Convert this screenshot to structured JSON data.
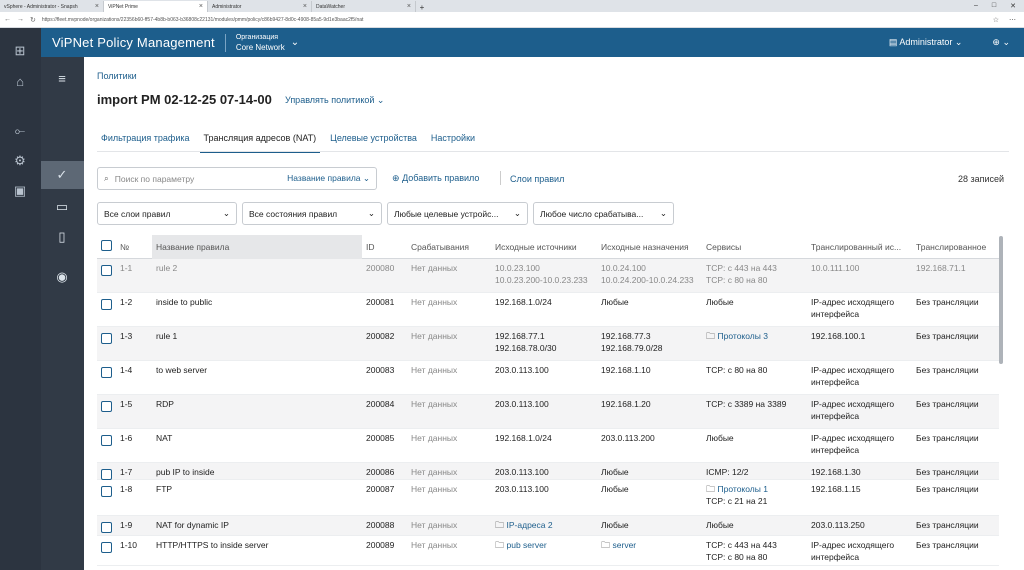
{
  "browser": {
    "tabs": [
      {
        "label": "vSphere - Administrator - Snapsh",
        "active": false
      },
      {
        "label": "ViPNet Prime",
        "active": true
      },
      {
        "label": "Administrator",
        "active": false
      },
      {
        "label": "DataWatcher",
        "active": false
      }
    ],
    "url": "https://fleet.mvpnode/organizations/22356b60-ff57-4b8b-b063-b36808c22131/modules/pmm/policy/c86b9427-8d0c-4908-85a5-9d1e3baac2f5/nat"
  },
  "header": {
    "app_name": "ViPNet Policy Management",
    "org_label": "Организация",
    "org_value": "Core Network",
    "user": "Administrator"
  },
  "page": {
    "breadcrumb": "Политики",
    "title": "import PM 02-12-25 07-14-00",
    "manage": "Управлять политикой",
    "tabs": [
      "Фильтрация трафика",
      "Трансляция адресов (NAT)",
      "Целевые устройства",
      "Настройки"
    ],
    "active_tab": 1,
    "search_placeholder": "Поиск по параметру",
    "search_field": "Название правила",
    "add_rule": "Добавить правило",
    "layers": "Слои правил",
    "records": "28 записей",
    "filters": [
      "Все слои правил",
      "Все состояния правил",
      "Любые целевые устройс...",
      "Любое число срабатыва..."
    ]
  },
  "table": {
    "columns": [
      "№",
      "Название правила",
      "ID",
      "Срабатывания",
      "Исходные источники",
      "Исходные назначения",
      "Сервисы",
      "Транслированный ис...",
      "Транслированное"
    ],
    "rows": [
      {
        "num": "1-1",
        "name": "rule 2",
        "id": "200080",
        "hits": "Нет данных",
        "src": [
          "10.0.23.100",
          "10.0.23.200-10.0.23.233"
        ],
        "dst": [
          "10.0.24.100",
          "10.0.24.200-10.0.24.233"
        ],
        "svc": [
          "TCP: с 443 на 443",
          "TCP: с 80 на 80"
        ],
        "tsrc": [
          "10.0.111.100"
        ],
        "tdst": [
          "192.168.71.1"
        ],
        "disabled": true
      },
      {
        "num": "1-2",
        "name": "inside to public",
        "id": "200081",
        "hits": "Нет данных",
        "src": [
          "192.168.1.0/24"
        ],
        "dst": [
          "Любые"
        ],
        "svc": [
          "Любые"
        ],
        "tsrc": [
          "IP-адрес исходящего",
          "интерфейса"
        ],
        "tdst": [
          "Без трансляции"
        ]
      },
      {
        "num": "1-3",
        "name": "rule 1",
        "id": "200082",
        "hits": "Нет данных",
        "src": [
          "192.168.77.1",
          "192.168.78.0/30"
        ],
        "dst": [
          "192.168.77.3",
          "192.168.79.0/28"
        ],
        "svc": [
          "Протоколы 3"
        ],
        "svc_folder": true,
        "tsrc": [
          "192.168.100.1"
        ],
        "tdst": [
          "Без трансляции"
        ]
      },
      {
        "num": "1-4",
        "name": "to web server",
        "id": "200083",
        "hits": "Нет данных",
        "src": [
          "203.0.113.100"
        ],
        "dst": [
          "192.168.1.10"
        ],
        "svc": [
          "TCP: с 80 на 80"
        ],
        "tsrc": [
          "IP-адрес исходящего",
          "интерфейса"
        ],
        "tdst": [
          "Без трансляции"
        ]
      },
      {
        "num": "1-5",
        "name": "RDP",
        "id": "200084",
        "hits": "Нет данных",
        "src": [
          "203.0.113.100"
        ],
        "dst": [
          "192.168.1.20"
        ],
        "svc": [
          "TCP: с 3389 на 3389"
        ],
        "tsrc": [
          "IP-адрес исходящего",
          "интерфейса"
        ],
        "tdst": [
          "Без трансляции"
        ]
      },
      {
        "num": "1-6",
        "name": "NAT",
        "id": "200085",
        "hits": "Нет данных",
        "src": [
          "192.168.1.0/24"
        ],
        "dst": [
          "203.0.113.200"
        ],
        "svc": [
          "Любые"
        ],
        "tsrc": [
          "IP-адрес исходящего",
          "интерфейса"
        ],
        "tdst": [
          "Без трансляции"
        ]
      },
      {
        "num": "1-7",
        "name": "pub IP to inside",
        "id": "200086",
        "hits": "Нет данных",
        "src": [
          "203.0.113.100"
        ],
        "dst": [
          "Любые"
        ],
        "svc": [
          "ICMP: 12/2"
        ],
        "tsrc": [
          "192.168.1.30"
        ],
        "tdst": [
          "Без трансляции"
        ]
      },
      {
        "num": "1-8",
        "name": "FTP",
        "id": "200087",
        "hits": "Нет данных",
        "src": [
          "203.0.113.100"
        ],
        "dst": [
          "Любые"
        ],
        "svc": [
          "Протоколы 1",
          "TCP: с 21 на 21"
        ],
        "svc_folder": true,
        "tsrc": [
          "192.168.1.15"
        ],
        "tdst": [
          "Без трансляции"
        ]
      },
      {
        "num": "1-9",
        "name": "NAT for dynamic IP",
        "id": "200088",
        "hits": "Нет данных",
        "src": [
          "IP-адреса 2"
        ],
        "src_folder": true,
        "dst": [
          "Любые"
        ],
        "svc": [
          "Любые"
        ],
        "tsrc": [
          "203.0.113.250"
        ],
        "tdst": [
          "Без трансляции"
        ]
      },
      {
        "num": "1-10",
        "name": "HTTP/HTTPS to inside server",
        "id": "200089",
        "hits": "Нет данных",
        "src": [
          "pub server"
        ],
        "src_folder": true,
        "dst": [
          "server"
        ],
        "dst_folder": true,
        "svc": [
          "TCP: с 443 на 443",
          "TCP: с 80 на 80"
        ],
        "tsrc": [
          "IP-адрес исходящего",
          "интерфейса"
        ],
        "tdst": [
          "Без трансляции"
        ]
      }
    ]
  }
}
